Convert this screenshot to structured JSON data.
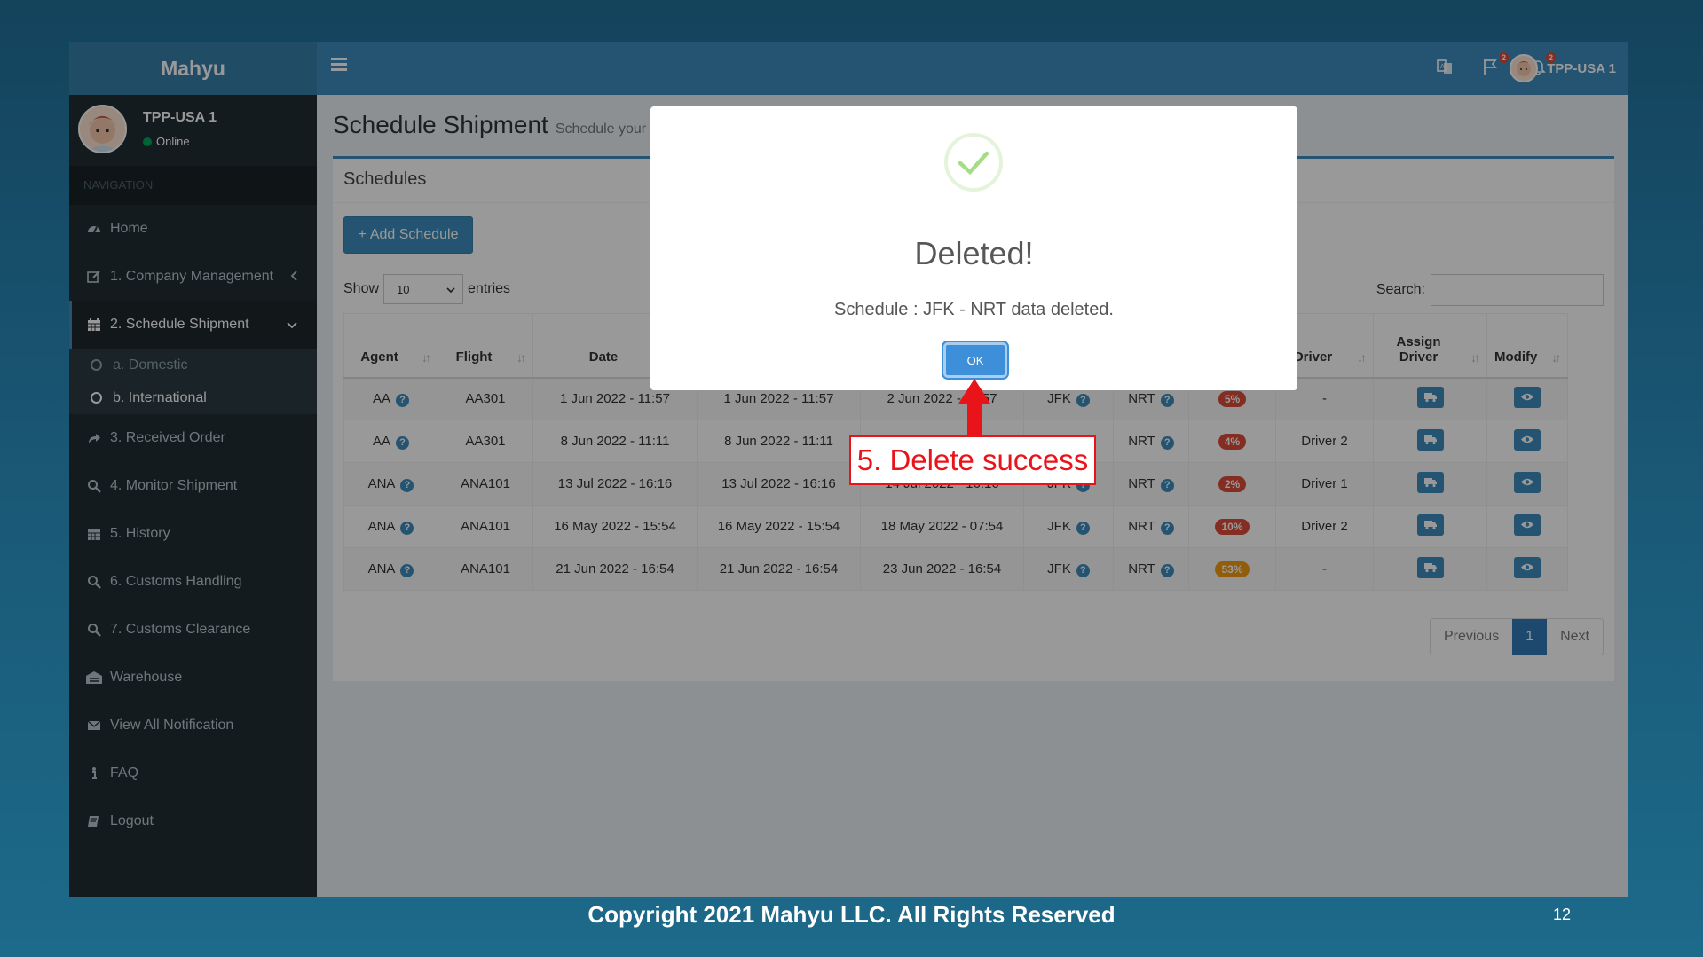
{
  "app": {
    "logo": "Mahyu"
  },
  "topbar": {
    "user_name": "TPP-USA 1",
    "flag_count": "2",
    "bell_count": "2"
  },
  "sidebar": {
    "user_name": "TPP-USA 1",
    "status": "Online",
    "nav_header": "NAVIGATION",
    "items": [
      {
        "label": "Home",
        "icon": "dashboard-icon"
      },
      {
        "label": "1. Company Management",
        "icon": "edit-icon"
      },
      {
        "label": "2. Schedule Shipment",
        "icon": "calendar-icon"
      },
      {
        "label": "3. Received Order",
        "icon": "share-icon"
      },
      {
        "label": "4. Monitor Shipment",
        "icon": "search-icon"
      },
      {
        "label": "5. History",
        "icon": "calendar-icon"
      },
      {
        "label": "6. Customs Handling",
        "icon": "search-icon"
      },
      {
        "label": "7. Customs Clearance",
        "icon": "search-icon"
      },
      {
        "label": "Warehouse",
        "icon": "warehouse-icon"
      },
      {
        "label": "View All Notification",
        "icon": "envelope-icon"
      },
      {
        "label": "FAQ",
        "icon": "info-icon"
      },
      {
        "label": "Logout",
        "icon": "book-icon"
      }
    ],
    "sub_items": [
      {
        "label": "a. Domestic"
      },
      {
        "label": "b. International"
      }
    ]
  },
  "page": {
    "title": "Schedule Shipment",
    "subtitle": "Schedule your"
  },
  "box": {
    "title": "Schedules",
    "add_button": "Add Schedule",
    "show_label": "Show",
    "entries_label": "entries",
    "page_length": "10",
    "search_label": "Search:"
  },
  "table": {
    "headers": [
      "Agent",
      "Flight",
      "Date",
      "",
      "",
      "",
      "",
      "",
      "Driver",
      "Assign Driver",
      "Modify"
    ],
    "rows": [
      {
        "agent": "AA",
        "flight": "AA301",
        "date": "1 Jun 2022 - 11:57",
        "d2": "1 Jun 2022 - 11:57",
        "d3": "2 Jun 2022 - 11:57",
        "from": "JFK",
        "to": "NRT",
        "progress": "5%",
        "progress_color": "#dd4b39",
        "driver": "-"
      },
      {
        "agent": "AA",
        "flight": "AA301",
        "date": "8 Jun 2022 - 11:11",
        "d2": "8 Jun 2022 - 11:11",
        "d3": "",
        "from": "",
        "to": "NRT",
        "progress": "4%",
        "progress_color": "#dd4b39",
        "driver": "Driver 2"
      },
      {
        "agent": "ANA",
        "flight": "ANA101",
        "date": "13 Jul 2022 - 16:16",
        "d2": "13 Jul 2022 - 16:16",
        "d3": "14 Jul 2022 - 16:16",
        "from": "JFK",
        "to": "NRT",
        "progress": "2%",
        "progress_color": "#dd4b39",
        "driver": "Driver 1"
      },
      {
        "agent": "ANA",
        "flight": "ANA101",
        "date": "16 May 2022 - 15:54",
        "d2": "16 May 2022 - 15:54",
        "d3": "18 May 2022 - 07:54",
        "from": "JFK",
        "to": "NRT",
        "progress": "10%",
        "progress_color": "#dd4b39",
        "driver": "Driver 2"
      },
      {
        "agent": "ANA",
        "flight": "ANA101",
        "date": "21 Jun 2022 - 16:54",
        "d2": "21 Jun 2022 - 16:54",
        "d3": "23 Jun 2022 - 16:54",
        "from": "JFK",
        "to": "NRT",
        "progress": "53%",
        "progress_color": "#f39c12",
        "driver": "-"
      }
    ]
  },
  "pagination": {
    "previous": "Previous",
    "current": "1",
    "next": "Next"
  },
  "modal": {
    "title": "Deleted!",
    "text": "Schedule : JFK - NRT data deleted.",
    "ok": "OK"
  },
  "callout": {
    "text": "5. Delete success",
    "color": "#e8141a"
  },
  "footer": {
    "copyright": "Copyright 2021 Mahyu LLC. All Rights Reserved",
    "page_number": "12"
  }
}
